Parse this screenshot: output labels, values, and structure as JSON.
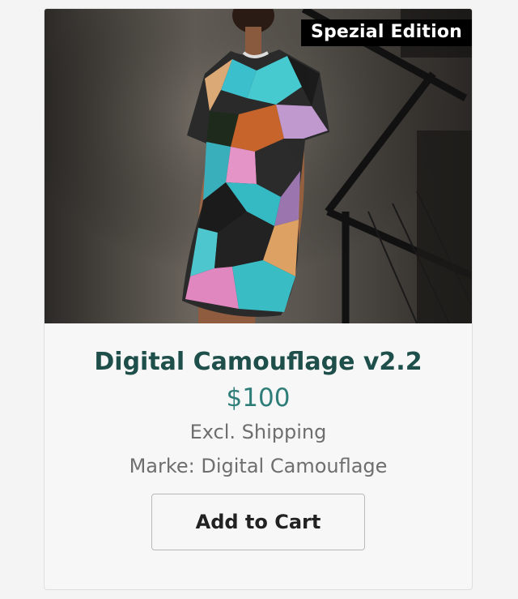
{
  "product": {
    "badge": "Spezial Edition",
    "title": "Digital Camouflage v2.2",
    "price": "$100",
    "shipping_note": "Excl. Shipping",
    "brand": "Marke: Digital Camouflage",
    "image_alt": "Model wearing colorful patchwork t-shirt dress"
  },
  "actions": {
    "add_to_cart_label": "Add to Cart"
  },
  "colors": {
    "title": "#1f4f4a",
    "price": "#2e7d78",
    "muted_text": "#6e6e6e",
    "badge_bg": "#000000",
    "badge_text": "#ffffff"
  }
}
